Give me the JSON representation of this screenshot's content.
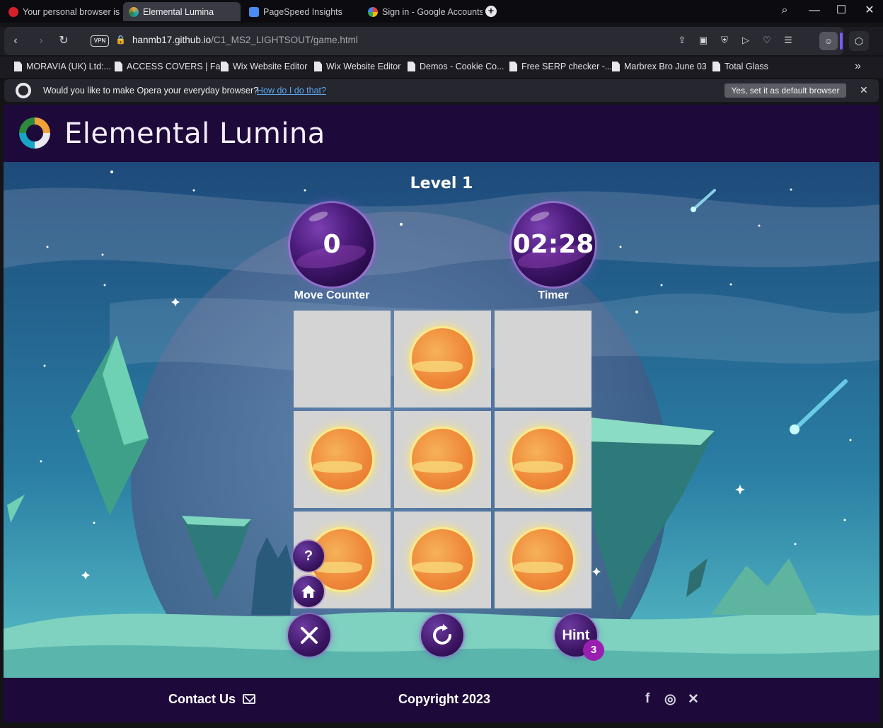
{
  "browser": {
    "tabs": [
      {
        "label": "Your personal browser is a",
        "active": false
      },
      {
        "label": "Elemental Lumina",
        "active": true
      },
      {
        "label": "PageSpeed Insights",
        "active": false
      },
      {
        "label": "Sign in - Google Accounts",
        "active": false
      }
    ],
    "url_host": "hanmb17.github.io",
    "url_path": "/C1_MS2_LIGHTSOUT/game.html",
    "vpn_label": "VPN",
    "bookmarks": [
      "MORAVIA (UK) Ltd:...",
      "ACCESS COVERS | Fa...",
      "Wix Website Editor",
      "Wix Website Editor",
      "Demos - Cookie Co...",
      "Free SERP checker -...",
      "Marbrex Bro June 03",
      "Total Glass"
    ],
    "infobar": {
      "message": "Would you like to make Opera your everyday browser?",
      "link": "How do I do that?",
      "button": "Yes, set it as default browser"
    }
  },
  "game": {
    "brand": "Elemental Lumina",
    "level": "Level 1",
    "moves": "0",
    "moves_label": "Move Counter",
    "timer": "02:28",
    "timer_label": "Timer",
    "grid": [
      [
        false,
        true,
        false
      ],
      [
        true,
        true,
        true
      ],
      [
        true,
        true,
        true
      ]
    ],
    "help_label": "?",
    "hint_label": "Hint",
    "hint_count": "3"
  },
  "footer": {
    "contact": "Contact Us",
    "copyright": "Copyright 2023",
    "social": [
      "facebook-icon",
      "instagram-icon",
      "x-icon"
    ]
  },
  "colors": {
    "header_bg": "#1e0a3a",
    "cell_bg": "#d4d4d4",
    "accent": "#9a1fb0"
  }
}
